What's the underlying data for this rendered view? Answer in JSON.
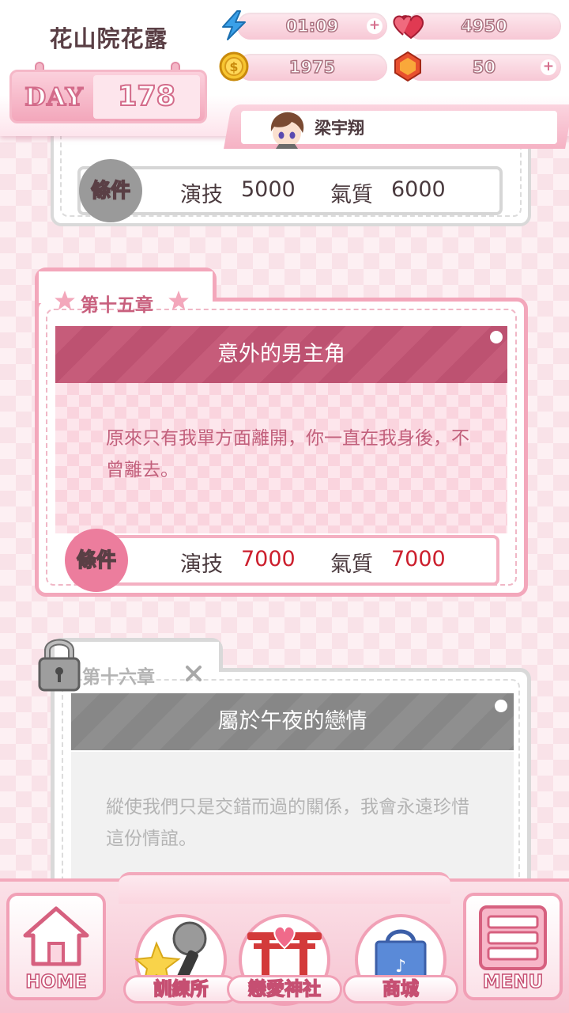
{
  "header": {
    "player_name": "花山院花露",
    "day_label": "DAY",
    "day_value": "178",
    "energy": "01:09",
    "hearts": "4950",
    "coins": "1975",
    "gems": "50",
    "partner_name": "梁宇翔"
  },
  "prev_chapter": {
    "condition_label": "條件",
    "stat1_name": "演技",
    "stat1_value": "5000",
    "stat2_name": "氣質",
    "stat2_value": "6000"
  },
  "chapter15": {
    "tab_label": "第十五章",
    "title": "意外的男主角",
    "description": "原來只有我單方面離開，你一直在我身後，不曾離去。",
    "condition_label": "條件",
    "stat1_name": "演技",
    "stat1_value": "7000",
    "stat2_name": "氣質",
    "stat2_value": "7000"
  },
  "chapter16": {
    "tab_label": "第十六章",
    "title": "屬於午夜的戀情",
    "description": "縱使我們只是交錯而過的關係，我會永遠珍惜這份情誼。",
    "locked": true
  },
  "nav": {
    "home": "HOME",
    "training": "訓練所",
    "shrine": "戀愛神社",
    "shop": "商城",
    "menu": "MENU"
  },
  "colors": {
    "accent_pink": "#ec7d9d",
    "title_bar": "#c85f7d",
    "requirement_unmet": "#cc1f2d",
    "locked_gray": "#8a8a8a"
  }
}
